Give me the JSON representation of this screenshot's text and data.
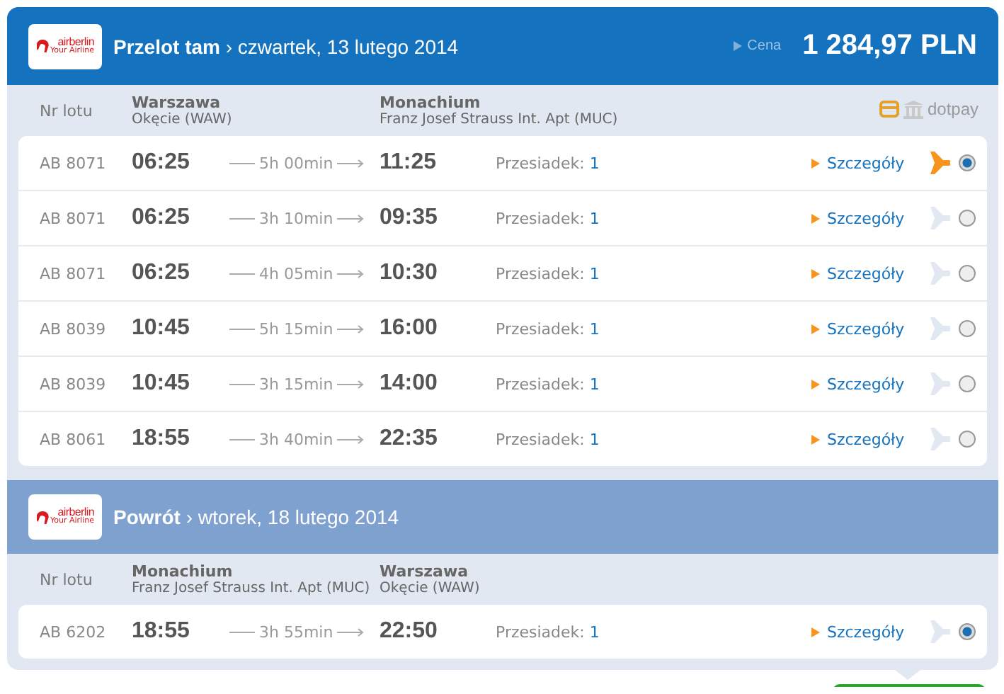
{
  "sections": [
    {
      "kind": "outbound",
      "logo_text": "airberlin",
      "logo_tagline": "Your Airline",
      "title": "Przelot tam",
      "separator": "›",
      "date": "czwartek, 13 lutego 2014",
      "price_label": "Cena",
      "price": "1 284,97 PLN",
      "payment": "dotpay",
      "columns": {
        "flight": "Nr lotu",
        "from_city": "Warszawa",
        "from_airport": "Okęcie (WAW)",
        "to_city": "Monachium",
        "to_airport": "Franz Josef Strauss Int. Apt (MUC)"
      },
      "rows": [
        {
          "flight": "AB 8071",
          "dep": "06:25",
          "duration": "5h 00min",
          "arr": "11:25",
          "stops_label": "Przesiadek:",
          "stops": "1",
          "details": "Szczegóły",
          "highlighted": true,
          "selected": true
        },
        {
          "flight": "AB 8071",
          "dep": "06:25",
          "duration": "3h 10min",
          "arr": "09:35",
          "stops_label": "Przesiadek:",
          "stops": "1",
          "details": "Szczegóły",
          "highlighted": false,
          "selected": false
        },
        {
          "flight": "AB 8071",
          "dep": "06:25",
          "duration": "4h 05min",
          "arr": "10:30",
          "stops_label": "Przesiadek:",
          "stops": "1",
          "details": "Szczegóły",
          "highlighted": false,
          "selected": false
        },
        {
          "flight": "AB 8039",
          "dep": "10:45",
          "duration": "5h 15min",
          "arr": "16:00",
          "stops_label": "Przesiadek:",
          "stops": "1",
          "details": "Szczegóły",
          "highlighted": false,
          "selected": false
        },
        {
          "flight": "AB 8039",
          "dep": "10:45",
          "duration": "3h 15min",
          "arr": "14:00",
          "stops_label": "Przesiadek:",
          "stops": "1",
          "details": "Szczegóły",
          "highlighted": false,
          "selected": false
        },
        {
          "flight": "AB 8061",
          "dep": "18:55",
          "duration": "3h 40min",
          "arr": "22:35",
          "stops_label": "Przesiadek:",
          "stops": "1",
          "details": "Szczegóły",
          "highlighted": false,
          "selected": false
        }
      ]
    },
    {
      "kind": "return",
      "logo_text": "airberlin",
      "logo_tagline": "Your Airline",
      "title": "Powrót",
      "separator": "›",
      "date": "wtorek, 18 lutego 2014",
      "columns": {
        "flight": "Nr lotu",
        "from_city": "Monachium",
        "from_airport": "Franz Josef Strauss Int. Apt (MUC)",
        "to_city": "Warszawa",
        "to_airport": "Okęcie (WAW)"
      },
      "rows": [
        {
          "flight": "AB 6202",
          "dep": "18:55",
          "duration": "3h 55min",
          "arr": "22:50",
          "stops_label": "Przesiadek:",
          "stops": "1",
          "details": "Szczegóły",
          "highlighted": false,
          "selected": true
        }
      ]
    }
  ]
}
